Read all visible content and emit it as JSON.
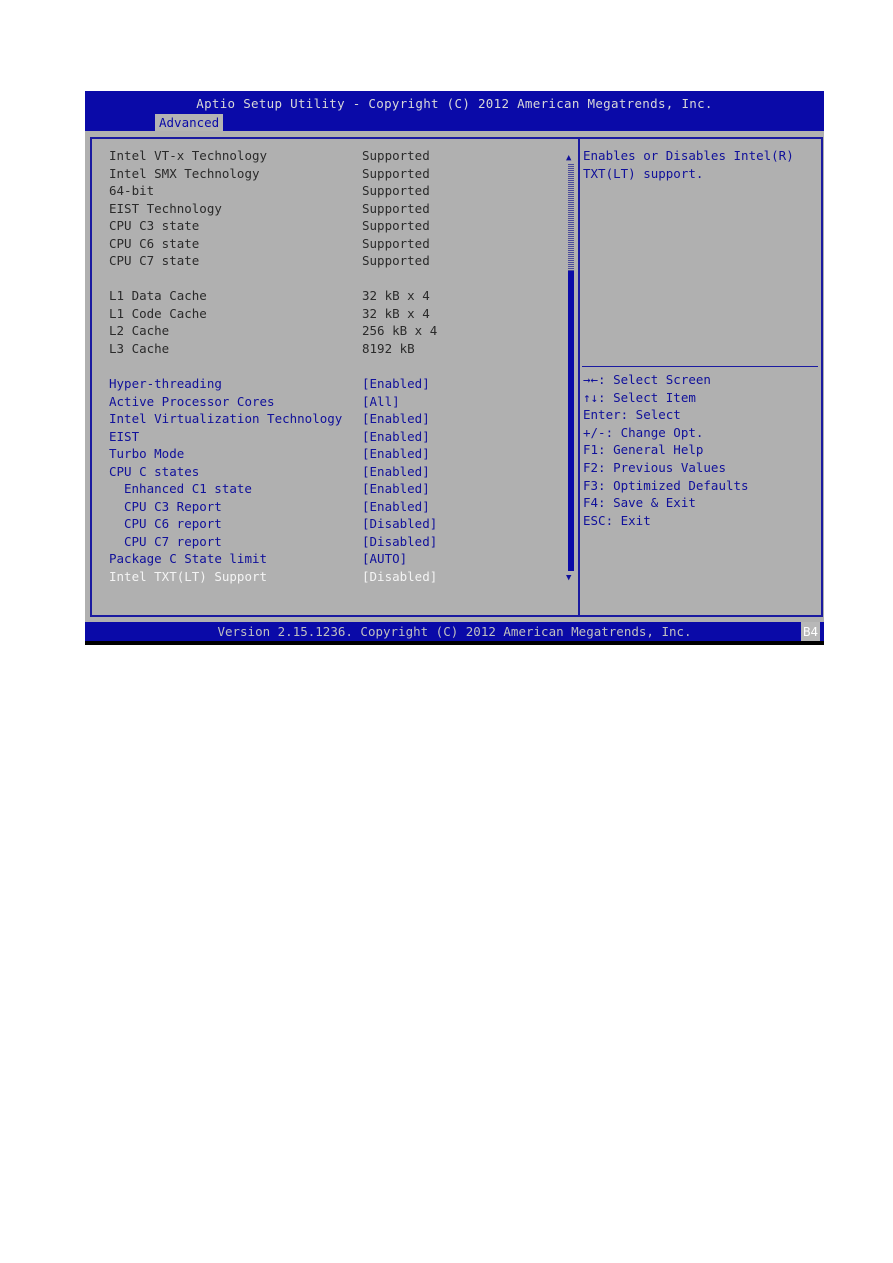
{
  "header": {
    "title": "Aptio Setup Utility - Copyright (C) 2012 American Megatrends, Inc.",
    "active_tab": "Advanced"
  },
  "info_items": [
    {
      "label": "Intel VT-x Technology",
      "value": "Supported"
    },
    {
      "label": "Intel SMX Technology",
      "value": "Supported"
    },
    {
      "label": "64-bit",
      "value": "Supported"
    },
    {
      "label": "EIST Technology",
      "value": "Supported"
    },
    {
      "label": "CPU C3 state",
      "value": "Supported"
    },
    {
      "label": "CPU C6 state",
      "value": "Supported"
    },
    {
      "label": "CPU C7 state",
      "value": "Supported"
    }
  ],
  "cache_items": [
    {
      "label": "L1 Data Cache",
      "value": "32 kB x 4"
    },
    {
      "label": "L1 Code Cache",
      "value": "32 kB x 4"
    },
    {
      "label": "L2 Cache",
      "value": "256 kB x 4"
    },
    {
      "label": "L3 Cache",
      "value": "8192 kB"
    }
  ],
  "options": [
    {
      "label": "Hyper-threading",
      "value": "[Enabled]"
    },
    {
      "label": "Active Processor Cores",
      "value": "[All]"
    },
    {
      "label": "Intel Virtualization Technology",
      "value": "[Enabled]"
    },
    {
      "label": "EIST",
      "value": "[Enabled]"
    },
    {
      "label": "Turbo Mode",
      "value": "[Enabled]"
    },
    {
      "label": "CPU C states",
      "value": "[Enabled]"
    },
    {
      "label": "Enhanced C1 state",
      "value": "[Enabled]"
    },
    {
      "label": "CPU C3 Report",
      "value": "[Enabled]"
    },
    {
      "label": "CPU C6 report",
      "value": "[Disabled]"
    },
    {
      "label": "CPU C7 report",
      "value": "[Disabled]"
    },
    {
      "label": "Package C State limit",
      "value": "[AUTO]"
    },
    {
      "label": "Intel TXT(LT) Support",
      "value": "[Disabled]"
    }
  ],
  "scrollbar": {
    "up_glyph": "▲",
    "down_glyph": "▼",
    "position_fraction": 0.24,
    "visible_fraction": 0.74
  },
  "help": {
    "description": "Enables or Disables Intel(R) TXT(LT) support.",
    "keys": [
      "→←: Select Screen",
      "↑↓: Select Item",
      "Enter: Select",
      "+/-: Change Opt.",
      "F1: General Help",
      "F2: Previous Values",
      "F3: Optimized Defaults",
      "F4: Save & Exit",
      "ESC: Exit"
    ]
  },
  "footer": {
    "version": "Version 2.15.1236. Copyright (C) 2012 American Megatrends, Inc.",
    "badge": "B4"
  },
  "colors": {
    "header_bg": "#0a0aa8",
    "body_bg": "#b0b0b0",
    "option_text": "#10109a",
    "selected_text": "#f4f4f4"
  }
}
